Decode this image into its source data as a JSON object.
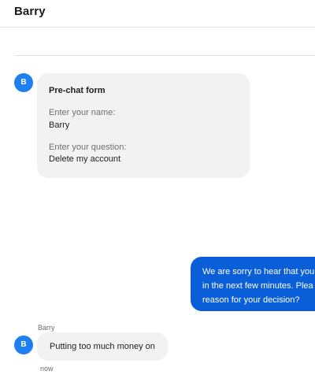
{
  "header": {
    "title": "Barry"
  },
  "messages": {
    "prechat": {
      "avatar_initial": "B",
      "title": "Pre-chat form",
      "name_label": "Enter your name:",
      "name_value": "Barry",
      "question_label": "Enter your question:",
      "question_value": "Delete my account"
    },
    "agent": {
      "lines": [
        "We are sorry to hear that you",
        "in the next few minutes. Plea",
        "reason for your decision?"
      ]
    },
    "user": {
      "avatar_initial": "B",
      "sender": "Barry",
      "text": "Putting too much money on",
      "timestamp": "now"
    }
  },
  "colors": {
    "avatar": "#1e7ff0",
    "agent_bubble": "#0a5fd8",
    "user_bubble": "#f2f2f2"
  }
}
